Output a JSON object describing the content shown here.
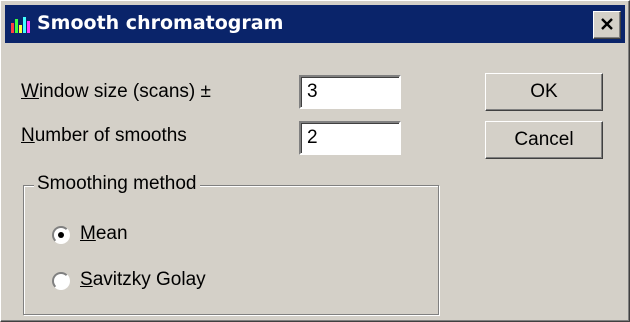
{
  "window": {
    "title": "Smooth chromatogram",
    "close_symbol": "×",
    "title_color": "#0a246a",
    "face_color": "#d4d0c8"
  },
  "fields": {
    "window_size": {
      "label_accel": "W",
      "label_rest": "indow size (scans) ±",
      "value": "3"
    },
    "number_of_smooths": {
      "label_accel": "N",
      "label_rest": "umber of smooths",
      "value": "2"
    }
  },
  "buttons": {
    "ok": "OK",
    "cancel": "Cancel"
  },
  "smoothing_method": {
    "legend": "Smoothing method",
    "options": [
      {
        "accel": "M",
        "rest": "ean",
        "selected": true
      },
      {
        "accel": "S",
        "rest": "avitzky Golay",
        "selected": false
      }
    ]
  }
}
